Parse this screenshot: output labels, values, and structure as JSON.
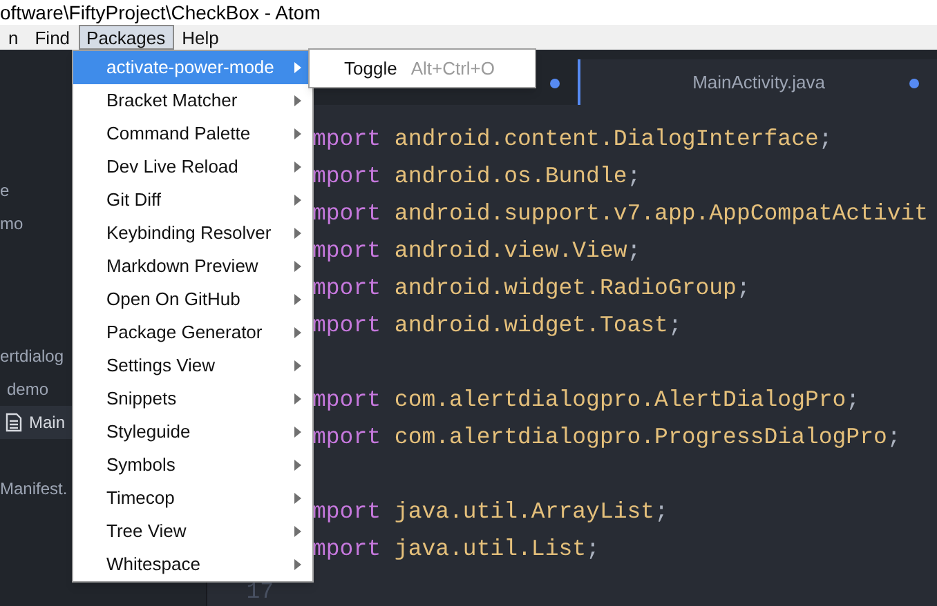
{
  "window": {
    "title": "oftware\\FiftyProject\\CheckBox - Atom"
  },
  "menu_bar": [
    {
      "label": "n",
      "selected": false
    },
    {
      "label": "Find",
      "selected": false
    },
    {
      "label": "Packages",
      "selected": true
    },
    {
      "label": "Help",
      "selected": false
    }
  ],
  "tree": {
    "groups": [
      [
        {
          "label": "e",
          "selected": false
        },
        {
          "label": "mo",
          "selected": false
        }
      ],
      [
        {
          "label": "ertdialog",
          "selected": false
        },
        {
          "label": "demo",
          "selected": false
        },
        {
          "label": "Main",
          "selected": true,
          "kind": "file"
        }
      ],
      [
        {
          "label": "Manifest.",
          "selected": false
        }
      ]
    ]
  },
  "tabs": [
    {
      "selected": false,
      "modified": true
    },
    {
      "label": "MainActivity.java",
      "selected": true,
      "modified": true
    }
  ],
  "code_lines": [
    {
      "kind": "import",
      "keyword": "mport",
      "path": "android.content.DialogInterface",
      "punct": ";"
    },
    {
      "kind": "import",
      "keyword": "mport",
      "path": "android.os.Bundle",
      "punct": ";"
    },
    {
      "kind": "import",
      "keyword": "mport",
      "path": "android.support.v7.app.AppCompatActivit"
    },
    {
      "kind": "import",
      "keyword": "mport",
      "path": "android.view.View",
      "punct": ";"
    },
    {
      "kind": "import",
      "keyword": "mport",
      "path": "android.widget.RadioGroup",
      "punct": ";"
    },
    {
      "kind": "import",
      "keyword": "mport",
      "path": "android.widget.Toast",
      "punct": ";"
    },
    {
      "kind": "blank"
    },
    {
      "kind": "import",
      "keyword": "mport",
      "path": "com.alertdialogpro.AlertDialogPro",
      "punct": ";"
    },
    {
      "kind": "import",
      "keyword": "mport",
      "path": "com.alertdialogpro.ProgressDialogPro",
      "punct": ";"
    },
    {
      "kind": "blank"
    },
    {
      "kind": "import",
      "keyword": "mport",
      "path": "java.util.ArrayList",
      "punct": ";"
    },
    {
      "kind": "import",
      "keyword": "mport",
      "path": "java.util.List",
      "punct": ";"
    },
    {
      "kind": "gutter",
      "line_number": "17"
    }
  ],
  "packages_menu": [
    {
      "label": "activate-power-mode",
      "selected": true
    },
    {
      "label": "Bracket Matcher",
      "selected": false
    },
    {
      "label": "Command Palette",
      "selected": false
    },
    {
      "label": "Dev Live Reload",
      "selected": false
    },
    {
      "label": "Git Diff",
      "selected": false
    },
    {
      "label": "Keybinding Resolver",
      "selected": false
    },
    {
      "label": "Markdown Preview",
      "selected": false
    },
    {
      "label": "Open On GitHub",
      "selected": false
    },
    {
      "label": "Package Generator",
      "selected": false
    },
    {
      "label": "Settings View",
      "selected": false
    },
    {
      "label": "Snippets",
      "selected": false
    },
    {
      "label": "Styleguide",
      "selected": false
    },
    {
      "label": "Symbols",
      "selected": false
    },
    {
      "label": "Timecop",
      "selected": false
    },
    {
      "label": "Tree View",
      "selected": false
    },
    {
      "label": "Whitespace",
      "selected": false
    }
  ],
  "submenu": [
    {
      "label": "Toggle",
      "shortcut": "Alt+Ctrl+O"
    }
  ]
}
